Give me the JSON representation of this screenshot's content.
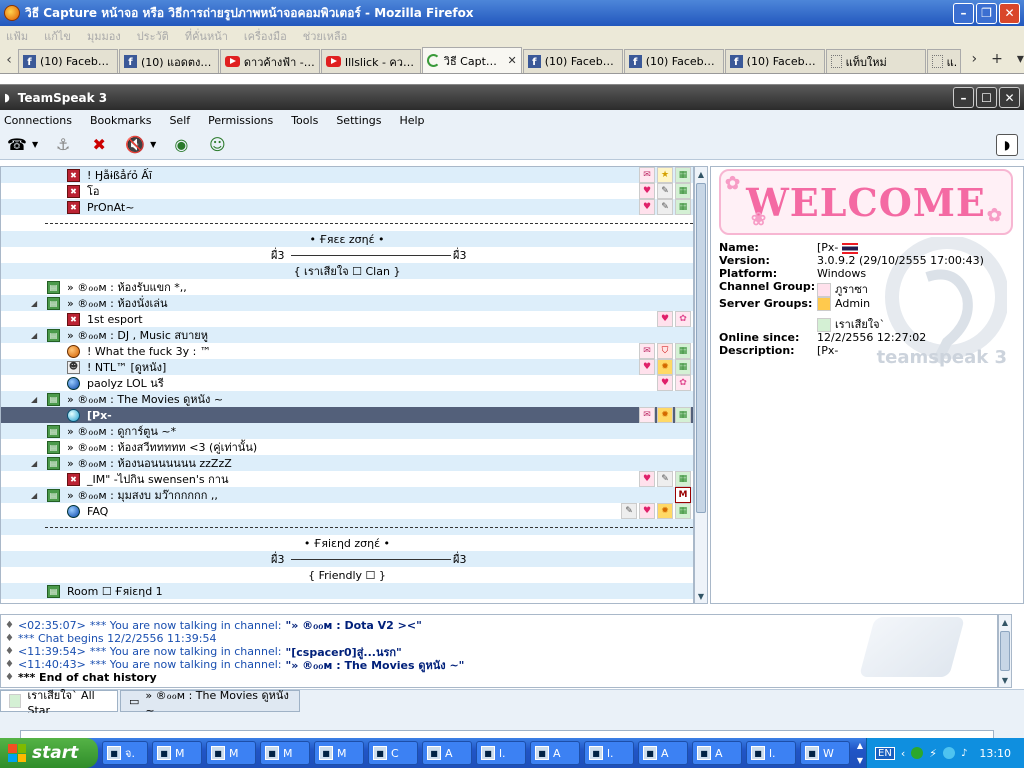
{
  "firefox": {
    "title": "วิธี Capture หน้าจอ หรือ วิธีการถ่ายรูปภาพหน้าจอคอมพิวเตอร์ - Mozilla Firefox",
    "menu": [
      "แฟ้ม",
      "แก้ไข",
      "มุมมอง",
      "ประวัติ",
      "ที่คั่นหน้า",
      "เครื่องมือ",
      "ช่วยเหลือ"
    ],
    "tabs": [
      {
        "label": "(10) Facebook",
        "icon": "facebook-icon"
      },
      {
        "label": "(10) แอดตง ข...",
        "icon": "facebook-icon"
      },
      {
        "label": "ดาวค้างฟ้า - IL...",
        "icon": "youtube-icon"
      },
      {
        "label": "Illslick - ความ...",
        "icon": "youtube-icon"
      },
      {
        "label": "วิธี Captur...",
        "icon": "loading-icon",
        "active": true
      },
      {
        "label": "(10) Facebook",
        "icon": "facebook-icon"
      },
      {
        "label": "(10) Facebook",
        "icon": "facebook-icon"
      },
      {
        "label": "(10) Facebook",
        "icon": "facebook-icon"
      },
      {
        "label": "แท็บใหม่",
        "icon": "blank-page-icon"
      },
      {
        "label": "แท็",
        "icon": "blank-page-icon"
      }
    ]
  },
  "teamspeak": {
    "title": "TeamSpeak 3",
    "menu": [
      "Connections",
      "Bookmarks",
      "Self",
      "Permissions",
      "Tools",
      "Settings",
      "Help"
    ],
    "tree": {
      "rows": [
        {
          "type": "user",
          "icon": "speaker-muted-icon",
          "text": "!  Ӈẵɨßẳŕỏ  Ấĩ",
          "badges": [
            "b-pm",
            "b-star",
            "b-check"
          ]
        },
        {
          "type": "user",
          "icon": "speaker-muted-icon",
          "text": "โอ",
          "badges": [
            "b-heart",
            "b-tool",
            "b-check"
          ]
        },
        {
          "type": "user",
          "icon": "speaker-muted-icon",
          "text": "PrOnAt~",
          "badges": [
            "b-heart",
            "b-tool",
            "b-check"
          ]
        },
        {
          "type": "separator"
        },
        {
          "type": "center",
          "text": "• Ғяεε zσηέ •"
        },
        {
          "type": "spacer",
          "left": "ผื่3",
          "right": "ผื่3"
        },
        {
          "type": "center",
          "text": "{ เราเสียใจ ☐ Clan }"
        },
        {
          "type": "channel",
          "text": "» ®ℴℴм :  ห้องรับแขก *,,"
        },
        {
          "type": "channel",
          "arrow": true,
          "text": "» ®ℴℴм :  ห้องนั่งเล่น"
        },
        {
          "type": "user",
          "icon": "speaker-muted-icon",
          "text": "1st esport",
          "badges": [
            "b-heart",
            "b-flower"
          ]
        },
        {
          "type": "channel",
          "arrow": true,
          "text": "» ®ℴℴм : DJ ,  Music สบายหู"
        },
        {
          "type": "user",
          "icon": "orange-status-icon",
          "text": "!   What the fuck 3y :  ™",
          "badges": [
            "b-pm",
            "b-shield",
            "b-check"
          ]
        },
        {
          "type": "user",
          "icon": "user-icon",
          "text": "!  NTL™ [ดูหนัง]",
          "badges": [
            "b-heart",
            "b-sun",
            "b-check"
          ]
        },
        {
          "type": "user",
          "icon": "blue-status-icon",
          "text": "paolyz  LOL นรี",
          "badges": [
            "b-heart",
            "b-flower"
          ]
        },
        {
          "type": "channel",
          "arrow": true,
          "text": "» ®ℴℴм : The Movies ดูหนัง ~"
        },
        {
          "type": "user",
          "icon": "cyan-status-icon",
          "text": "[Px-",
          "selected": true,
          "badges": [
            "b-pm",
            "b-sun",
            "b-check"
          ]
        },
        {
          "type": "channel",
          "text": "» ®ℴℴм : ดูการ์ตูน  ~*"
        },
        {
          "type": "channel",
          "text": "» ®ℴℴм : ห้องสวีททททท <3 (คู่เท่านั้น)"
        },
        {
          "type": "channel",
          "arrow": true,
          "text": "» ®ℴℴм : ห้องนอนนนนนน zzZzZ"
        },
        {
          "type": "user",
          "icon": "speaker-muted-icon",
          "text": "_IM\"  -ไปกิน swensen's กาน",
          "badges": [
            "b-heart",
            "b-tool",
            "b-check"
          ]
        },
        {
          "type": "channel",
          "arrow": true,
          "text": "» ®ℴℴм : มุมสงบ มว๊ากกกกก ,,",
          "badges": [
            "b-m"
          ]
        },
        {
          "type": "user",
          "icon": "blue-status-icon",
          "text": "FAQ",
          "badges": [
            "b-tool",
            "b-heart",
            "b-sun",
            "b-check"
          ]
        },
        {
          "type": "separator"
        },
        {
          "type": "center",
          "text": "• Ғяiεηd zσηέ •"
        },
        {
          "type": "spacer",
          "left": "ผื่3",
          "right": "ผื่3"
        },
        {
          "type": "center",
          "text": "{ Friendly ☐ }"
        },
        {
          "type": "channel",
          "text": "Room ☐ Ғяiεηd 1"
        }
      ]
    },
    "info": {
      "welcome": "WELCOME",
      "logo_text": "teamspeak 3",
      "fields": [
        {
          "key": "Name:",
          "value": "[Px-"
        },
        {
          "key": "Version:",
          "value": "3.0.9.2 (29/10/2555 17:00:43)"
        },
        {
          "key": "Platform:",
          "value": "Windows"
        },
        {
          "key": "Channel Group:",
          "value": "ภูราซา"
        },
        {
          "key": "Server Groups:",
          "value": "Admin"
        },
        {
          "key": "",
          "value": "เราเสียใจ`"
        },
        {
          "key": "Online since:",
          "value": "12/2/2556 12:27:02"
        },
        {
          "key": "Description:",
          "value": "[Px-"
        }
      ]
    },
    "chat": {
      "lines": [
        {
          "time": "<02:35:07>",
          "text": " *** You are now talking in channel: ",
          "channel": "\"» ®ℴℴм :  Dota V2 ><\""
        },
        {
          "time": "",
          "text": "*** Chat begins 12/2/2556 11:39:54",
          "channel": ""
        },
        {
          "time": "<11:39:54>",
          "text": " *** You are now talking in channel: ",
          "channel": "\"[cspacer0]สู่...นรก\""
        },
        {
          "time": "<11:40:43>",
          "text": " *** You are now talking in channel: ",
          "channel": "\"» ®ℴℴм : The Movies ดูหนัง ~\""
        },
        {
          "time": "",
          "text": "",
          "channel": "*** End of chat history"
        }
      ],
      "tabs": [
        "เราเสียใจ` All Star",
        "» ®ℴℴм : The Movies ดูหนัง ~"
      ]
    }
  },
  "taskbar": {
    "start": "start",
    "items": [
      "จ.",
      "M",
      "M",
      "M",
      "M",
      "C",
      "A",
      "l.",
      "A",
      "l.",
      "A",
      "A",
      "l.",
      "W"
    ],
    "lang": "EN",
    "clock": "13:10"
  }
}
